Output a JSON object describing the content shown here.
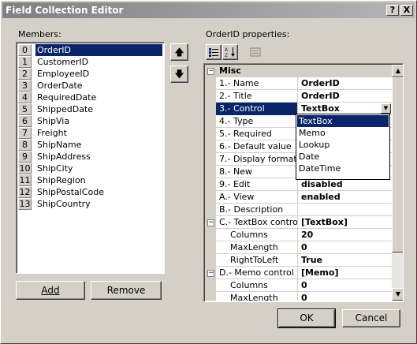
{
  "window": {
    "title": "Field Collection Editor",
    "help_label": "?",
    "close_label": "X"
  },
  "members": {
    "label": "Members:",
    "items": [
      {
        "index": "0",
        "name": "OrderID"
      },
      {
        "index": "1",
        "name": "CustomerID"
      },
      {
        "index": "2",
        "name": "EmployeeID"
      },
      {
        "index": "3",
        "name": "OrderDate"
      },
      {
        "index": "4",
        "name": "RequiredDate"
      },
      {
        "index": "5",
        "name": "ShippedDate"
      },
      {
        "index": "6",
        "name": "ShipVia"
      },
      {
        "index": "7",
        "name": "Freight"
      },
      {
        "index": "8",
        "name": "ShipName"
      },
      {
        "index": "9",
        "name": "ShipAddress"
      },
      {
        "index": "10",
        "name": "ShipCity"
      },
      {
        "index": "11",
        "name": "ShipRegion"
      },
      {
        "index": "12",
        "name": "ShipPostalCode"
      },
      {
        "index": "13",
        "name": "ShipCountry"
      }
    ],
    "selected_index": 0,
    "move_up_icon": "arrow-up-icon",
    "move_down_icon": "arrow-down-icon",
    "up_glyph": "🡅",
    "down_glyph": "🡇"
  },
  "buttons": {
    "add": "Add",
    "remove": "Remove",
    "ok": "OK",
    "cancel": "Cancel"
  },
  "properties": {
    "label": "OrderID properties:",
    "toolbar": {
      "categorized_icon": "categorized-icon",
      "alphabetical_icon": "alphabetical-icon",
      "property_pages_icon": "property-pages-icon"
    },
    "rows": [
      {
        "type": "category",
        "name": "Misc",
        "expander": "⊟"
      },
      {
        "name": "1.- Name",
        "value": "OrderID"
      },
      {
        "name": "2.- Title",
        "value": "OrderID"
      },
      {
        "name": "3.- Control",
        "value": "TextBox",
        "selected": true,
        "dropdown": true
      },
      {
        "name": "4.- Type",
        "value": ""
      },
      {
        "name": "5.- Required",
        "value": ""
      },
      {
        "name": "6.- Default value",
        "value": ""
      },
      {
        "name": "7.- Display format",
        "value": ""
      },
      {
        "name": "8.- New",
        "value": ""
      },
      {
        "name": "9.- Edit",
        "value": "disabled"
      },
      {
        "name": "A.- View",
        "value": "enabled"
      },
      {
        "name": "B.- Description",
        "value": ""
      },
      {
        "name": "C.- TextBox control",
        "value": "[TextBox]",
        "expander": "⊟"
      },
      {
        "name": "Columns",
        "value": "20",
        "sub": true
      },
      {
        "name": "MaxLength",
        "value": "0",
        "sub": true
      },
      {
        "name": "RightToLeft",
        "value": "True",
        "sub": true
      },
      {
        "name": "D.- Memo control",
        "value": "[Memo]",
        "expander": "⊟"
      },
      {
        "name": "Columns",
        "value": "0",
        "sub": true
      },
      {
        "name": "MaxLength",
        "value": "0",
        "sub": true
      }
    ]
  },
  "control_dropdown": {
    "options": [
      "TextBox",
      "Memo",
      "Lookup",
      "Date",
      "DateTime"
    ],
    "selected": "TextBox"
  },
  "colors": {
    "selection": "#0a246a",
    "face": "#d4d0c8"
  }
}
